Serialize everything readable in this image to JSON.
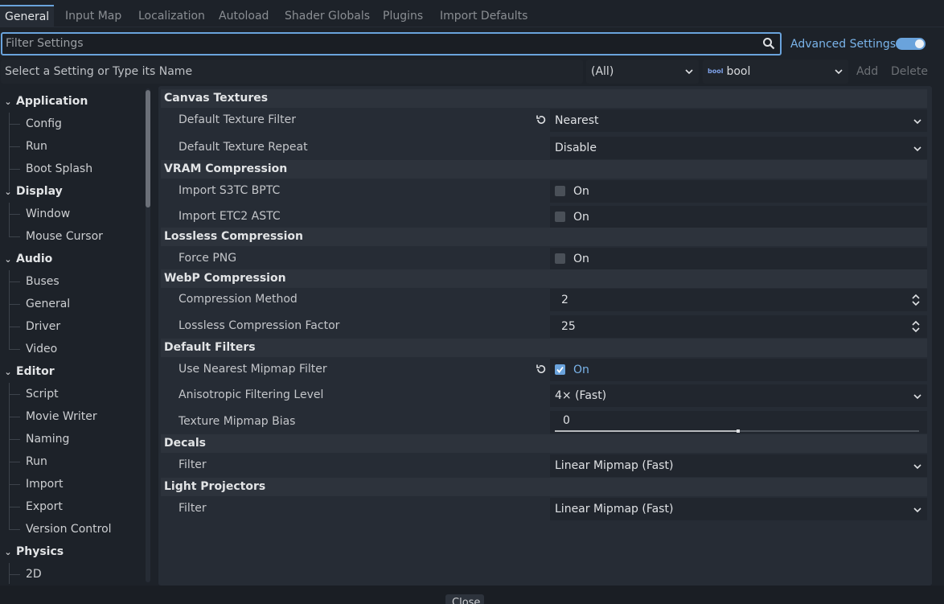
{
  "tabs": [
    {
      "label": "General",
      "active": true
    },
    {
      "label": "Input Map"
    },
    {
      "label": "Localization"
    },
    {
      "label": "Autoload"
    },
    {
      "label": "Shader Globals"
    },
    {
      "label": "Plugins"
    },
    {
      "label": "Import Defaults"
    }
  ],
  "filter": {
    "placeholder": "Filter Settings",
    "icon": "search-icon"
  },
  "advanced": {
    "label": "Advanced Settings",
    "enabled": true
  },
  "add_setting": {
    "name_placeholder": "Select a Setting or Type its Name",
    "scope_value": "(All)",
    "type_icon": "bool",
    "type_value": "bool",
    "add_label": "Add",
    "delete_label": "Delete"
  },
  "sidebar": [
    {
      "label": "Application",
      "type": "category"
    },
    {
      "label": "Config",
      "type": "sub"
    },
    {
      "label": "Run",
      "type": "sub"
    },
    {
      "label": "Boot Splash",
      "type": "sub"
    },
    {
      "label": "Display",
      "type": "category"
    },
    {
      "label": "Window",
      "type": "sub"
    },
    {
      "label": "Mouse Cursor",
      "type": "sub"
    },
    {
      "label": "Audio",
      "type": "category"
    },
    {
      "label": "Buses",
      "type": "sub"
    },
    {
      "label": "General",
      "type": "sub"
    },
    {
      "label": "Driver",
      "type": "sub"
    },
    {
      "label": "Video",
      "type": "sub"
    },
    {
      "label": "Editor",
      "type": "category"
    },
    {
      "label": "Script",
      "type": "sub"
    },
    {
      "label": "Movie Writer",
      "type": "sub"
    },
    {
      "label": "Naming",
      "type": "sub"
    },
    {
      "label": "Run",
      "type": "sub"
    },
    {
      "label": "Import",
      "type": "sub"
    },
    {
      "label": "Export",
      "type": "sub"
    },
    {
      "label": "Version Control",
      "type": "sub"
    },
    {
      "label": "Physics",
      "type": "category"
    },
    {
      "label": "2D",
      "type": "sub"
    }
  ],
  "sections": {
    "canvas_textures": "Canvas Textures",
    "vram_compression": "VRAM Compression",
    "lossless_compression": "Lossless Compression",
    "webp_compression": "WebP Compression",
    "default_filters": "Default Filters",
    "decals": "Decals",
    "light_projectors": "Light Projectors"
  },
  "settings": {
    "default_texture_filter": {
      "label": "Default Texture Filter",
      "value": "Nearest"
    },
    "default_texture_repeat": {
      "label": "Default Texture Repeat",
      "value": "Disable"
    },
    "import_s3tc_bptc": {
      "label": "Import S3TC BPTC",
      "value": "On"
    },
    "import_etc2_astc": {
      "label": "Import ETC2 ASTC",
      "value": "On"
    },
    "force_png": {
      "label": "Force PNG",
      "value": "On"
    },
    "compression_method": {
      "label": "Compression Method",
      "value": "2"
    },
    "lossless_factor": {
      "label": "Lossless Compression Factor",
      "value": "25"
    },
    "use_nearest_mipmap": {
      "label": "Use Nearest Mipmap Filter",
      "value": "On"
    },
    "anisotropic_level": {
      "label": "Anisotropic Filtering Level",
      "value": "4× (Fast)"
    },
    "mipmap_bias": {
      "label": "Texture Mipmap Bias",
      "value": "0",
      "slider_fraction": 0.5
    },
    "decals_filter": {
      "label": "Filter",
      "value": "Linear Mipmap (Fast)"
    },
    "light_filter": {
      "label": "Filter",
      "value": "Linear Mipmap (Fast)"
    }
  },
  "footer": {
    "close_label": "Close"
  },
  "colors": {
    "accent": "#6aa3dc",
    "background": "#1d2229",
    "panel": "#262c35"
  }
}
